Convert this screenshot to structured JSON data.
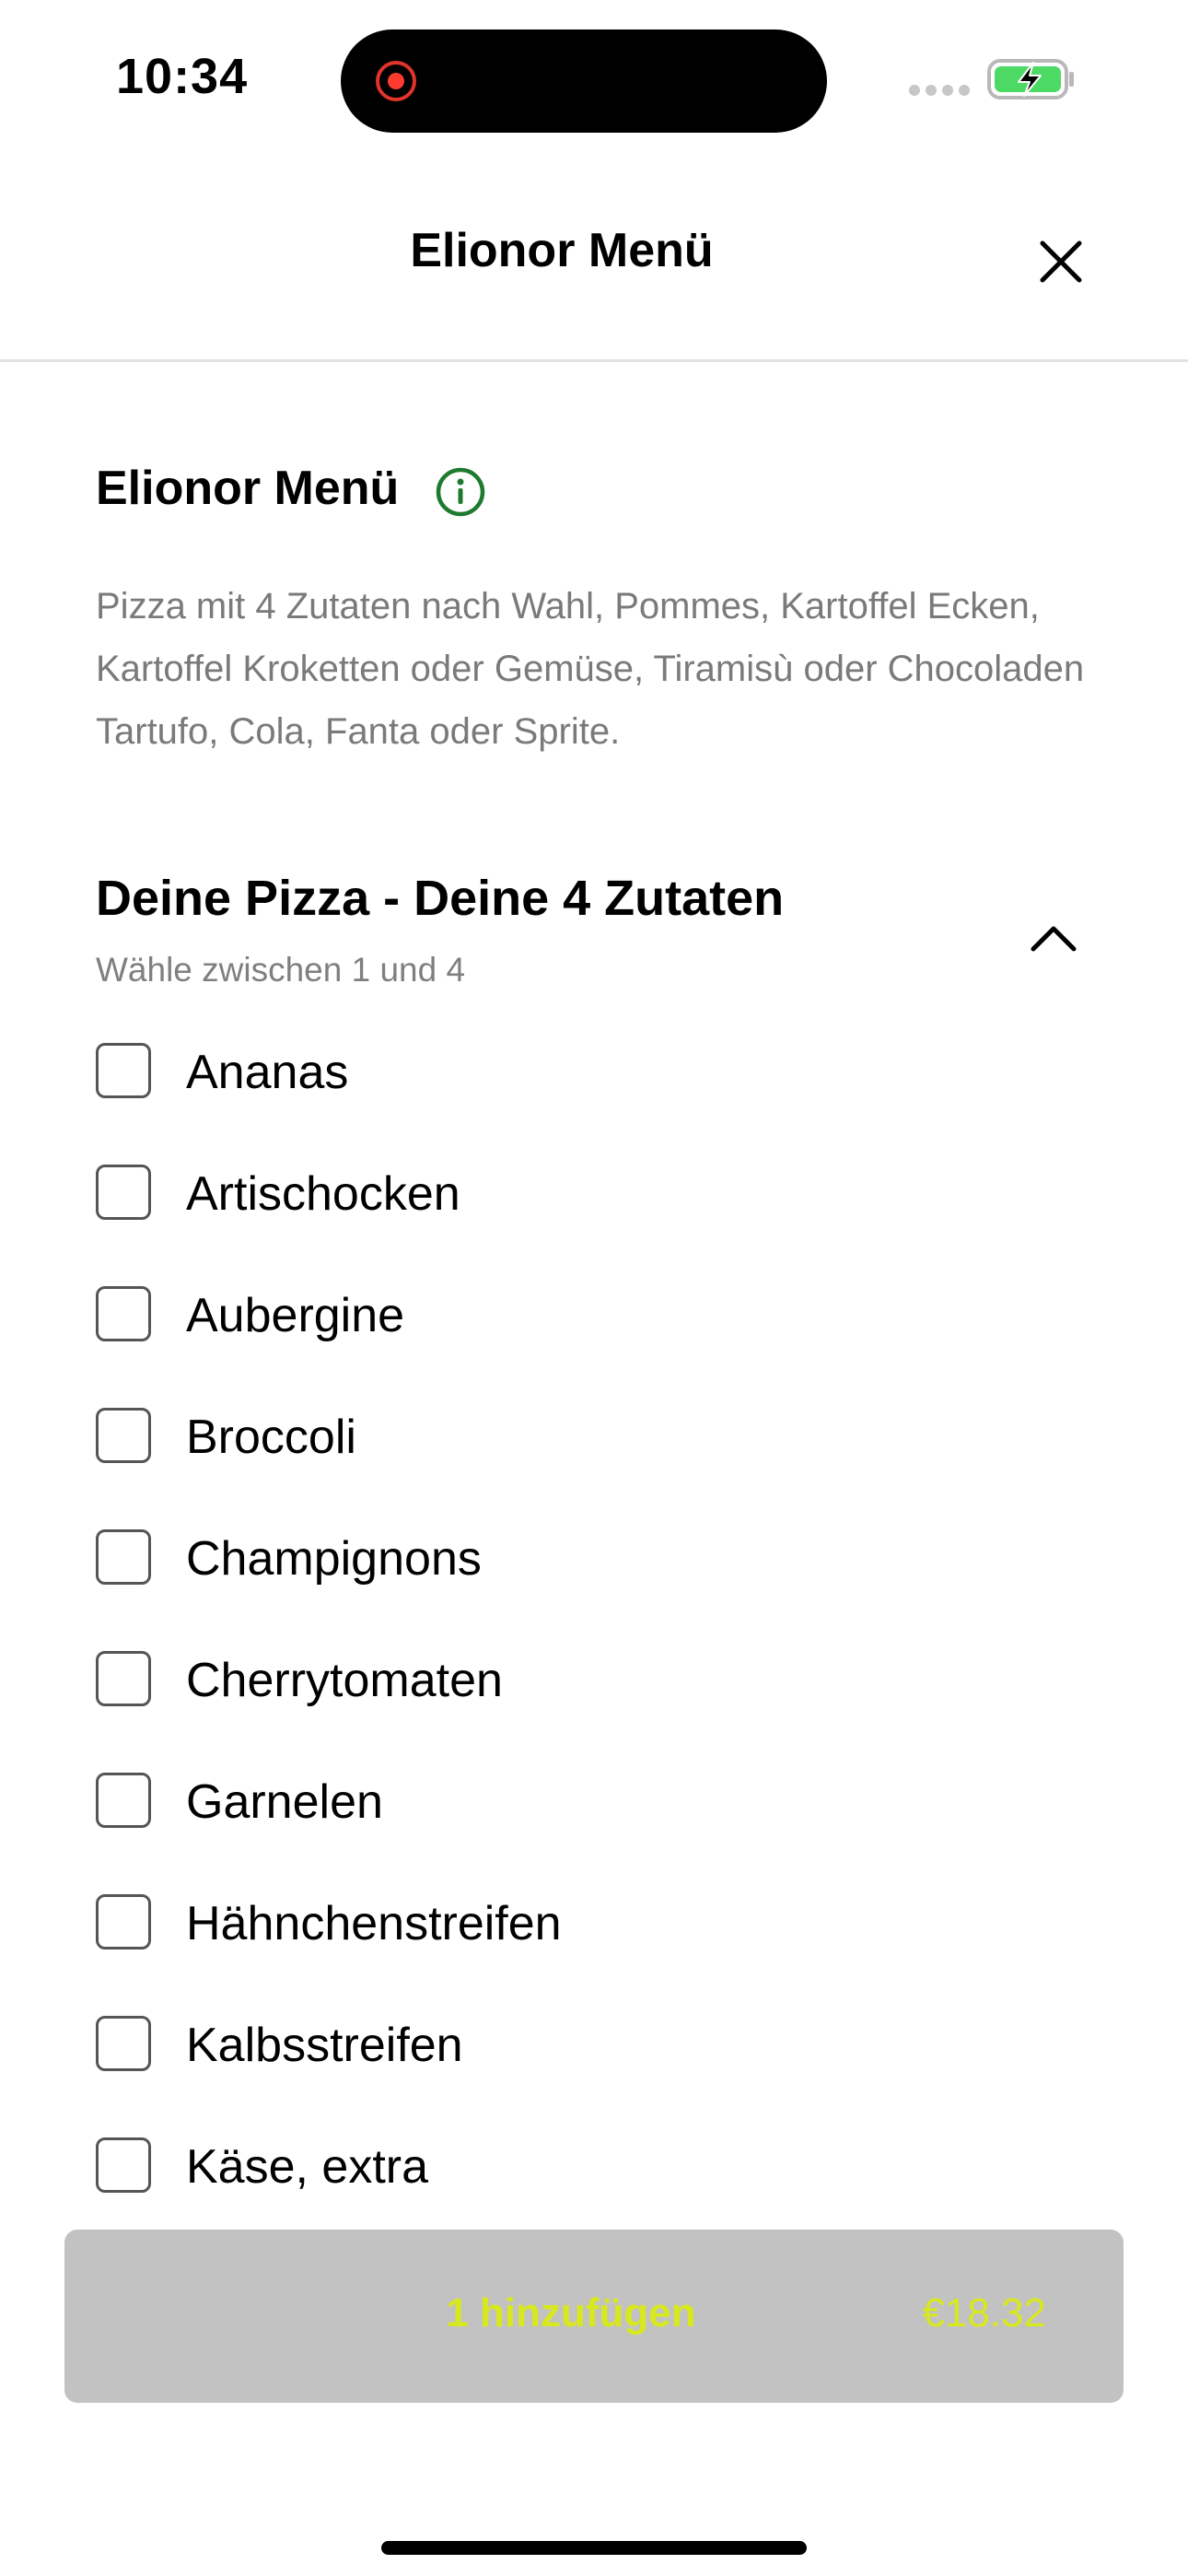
{
  "status_bar": {
    "time": "10:34"
  },
  "header": {
    "title": "Elionor Menü"
  },
  "menu": {
    "title": "Elionor Menü",
    "description": "Pizza  mit 4 Zutaten nach Wahl, Pommes,  Kartoffel Ecken, Kartoffel Kroketten oder Gemüse, Tiramisù oder Chocoladen Tartufo, Cola, Fanta oder Sprite."
  },
  "option_group": {
    "title": "Deine Pizza - Deine 4 Zutaten",
    "subtitle": "Wähle zwischen 1 und 4",
    "options": [
      {
        "label": "Ananas",
        "checked": false
      },
      {
        "label": "Artischocken",
        "checked": false
      },
      {
        "label": "Aubergine",
        "checked": false
      },
      {
        "label": "Broccoli",
        "checked": false
      },
      {
        "label": "Champignons",
        "checked": false
      },
      {
        "label": "Cherrytomaten",
        "checked": false
      },
      {
        "label": "Garnelen",
        "checked": false
      },
      {
        "label": "Hähnchenstreifen",
        "checked": false
      },
      {
        "label": "Kalbsstreifen",
        "checked": false
      },
      {
        "label": "Käse, extra",
        "checked": false
      }
    ]
  },
  "add_button": {
    "label": "1 hinzufügen",
    "price": "€18.32"
  },
  "colors": {
    "accent": "#d8e81f",
    "button_bg": "#c2c2c2",
    "info_green": "#1e7a2e",
    "battery_green": "#4cd964"
  },
  "icons": [
    "close-icon",
    "info-icon",
    "chevron-up-icon",
    "record-icon",
    "battery-charging-icon"
  ]
}
